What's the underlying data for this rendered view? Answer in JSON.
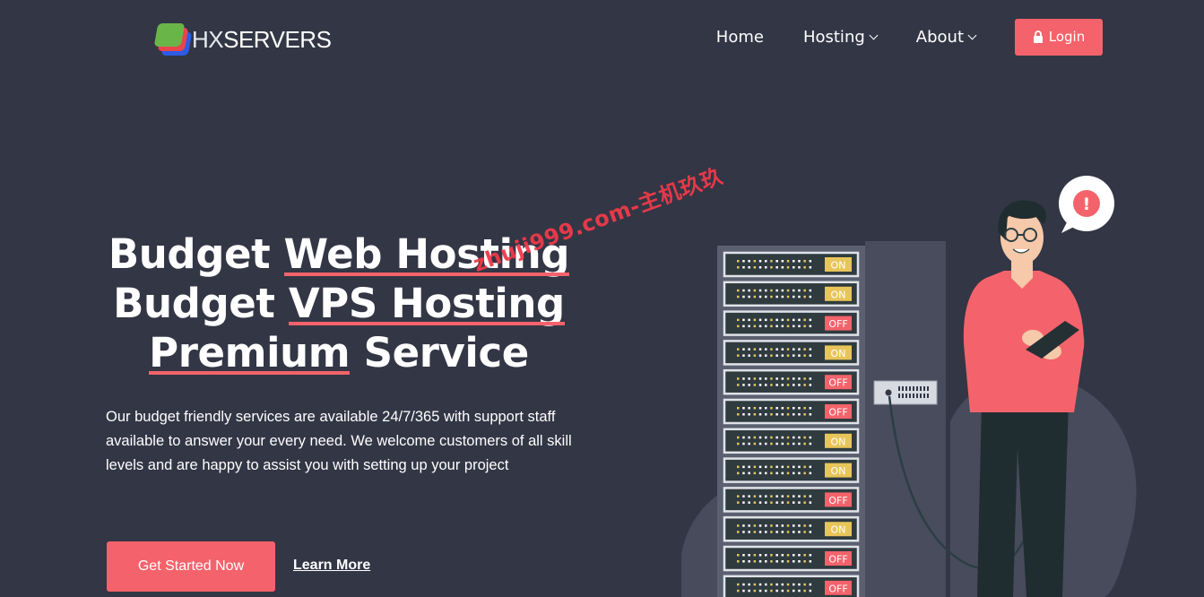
{
  "header": {
    "logo": {
      "mark_icon": "hxservers-logo-icon",
      "text_hx": "HX",
      "text_servers": "SERVERS"
    },
    "nav": {
      "home": "Home",
      "hosting": "Hosting",
      "about": "About",
      "login": "Login"
    }
  },
  "hero": {
    "headline": {
      "line1_prefix": "Budget",
      "line1_emphasis": "Web Hosting",
      "line2_prefix": "Budget",
      "line2_emphasis": "VPS Hosting",
      "line3_emphasis": "Premium",
      "line3_suffix": "Service"
    },
    "description": "Our budget friendly services are available 24/7/365 with support staff available to answer your every need. We welcome customers of all skill levels and are happy to assist you with setting up your project",
    "cta_primary": "Get Started Now",
    "cta_secondary": "Learn More"
  },
  "illustration": {
    "rack_status": [
      "ON",
      "ON",
      "OFF",
      "ON",
      "OFF",
      "OFF",
      "ON",
      "ON",
      "OFF",
      "ON",
      "OFF",
      "OFF"
    ],
    "alert_symbol": "!"
  },
  "watermark": "zhuji999.com-主机玖玖",
  "colors": {
    "background": "#333645",
    "accent": "#f4636b",
    "status_on": "#e8c55a",
    "status_off": "#f4636b"
  }
}
